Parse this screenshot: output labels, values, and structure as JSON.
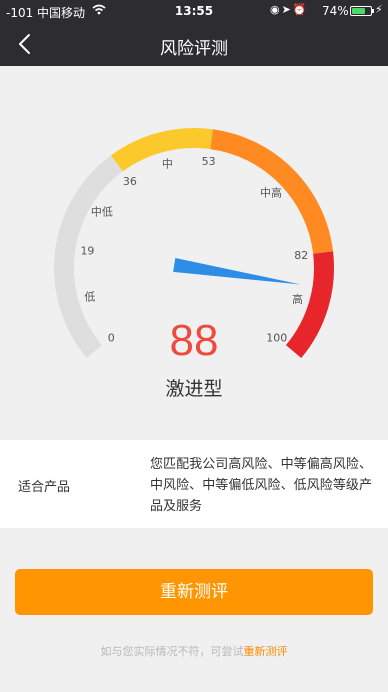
{
  "status_bar": {
    "carrier": "-101 中国移动",
    "time": "13:55",
    "battery": "74%",
    "battery_level": 0.74
  },
  "nav": {
    "title": "风险评测"
  },
  "gauge": {
    "score": "88",
    "score_value": 88,
    "min": 0,
    "max": 100,
    "result_label": "激进型",
    "tick_labels": [
      {
        "text": "0",
        "value": 0
      },
      {
        "text": "19",
        "value": 19
      },
      {
        "text": "36",
        "value": 36
      },
      {
        "text": "53",
        "value": 53
      },
      {
        "text": "82",
        "value": 82
      },
      {
        "text": "100",
        "value": 100
      }
    ],
    "band_labels": [
      {
        "text": "低",
        "value": 9.5
      },
      {
        "text": "中低",
        "value": 27.5
      },
      {
        "text": "中",
        "value": 44.5
      },
      {
        "text": "中高",
        "value": 67.5
      },
      {
        "text": "高",
        "value": 91
      }
    ],
    "segments": [
      {
        "from": 0,
        "to": 36,
        "color": "#dedede"
      },
      {
        "from": 36,
        "to": 53,
        "color": "#fcc92d"
      },
      {
        "from": 53,
        "to": 82,
        "color": "#ff8a22"
      },
      {
        "from": 82,
        "to": 100,
        "color": "#e6262a"
      }
    ],
    "colors": {
      "needle": "#2d8ce6",
      "score": "#ef4a3f",
      "tick_text": "#555555"
    }
  },
  "product": {
    "label": "适合产品",
    "description": "您匹配我公司高风险、中等偏高风险、中风险、中等偏低风险、低风险等级产品及服务"
  },
  "retest_button": {
    "label": "重新测评",
    "color": "#ff9500"
  },
  "footer": {
    "hint": "如与您实际情况不符，可尝试",
    "link": "重新测评"
  }
}
